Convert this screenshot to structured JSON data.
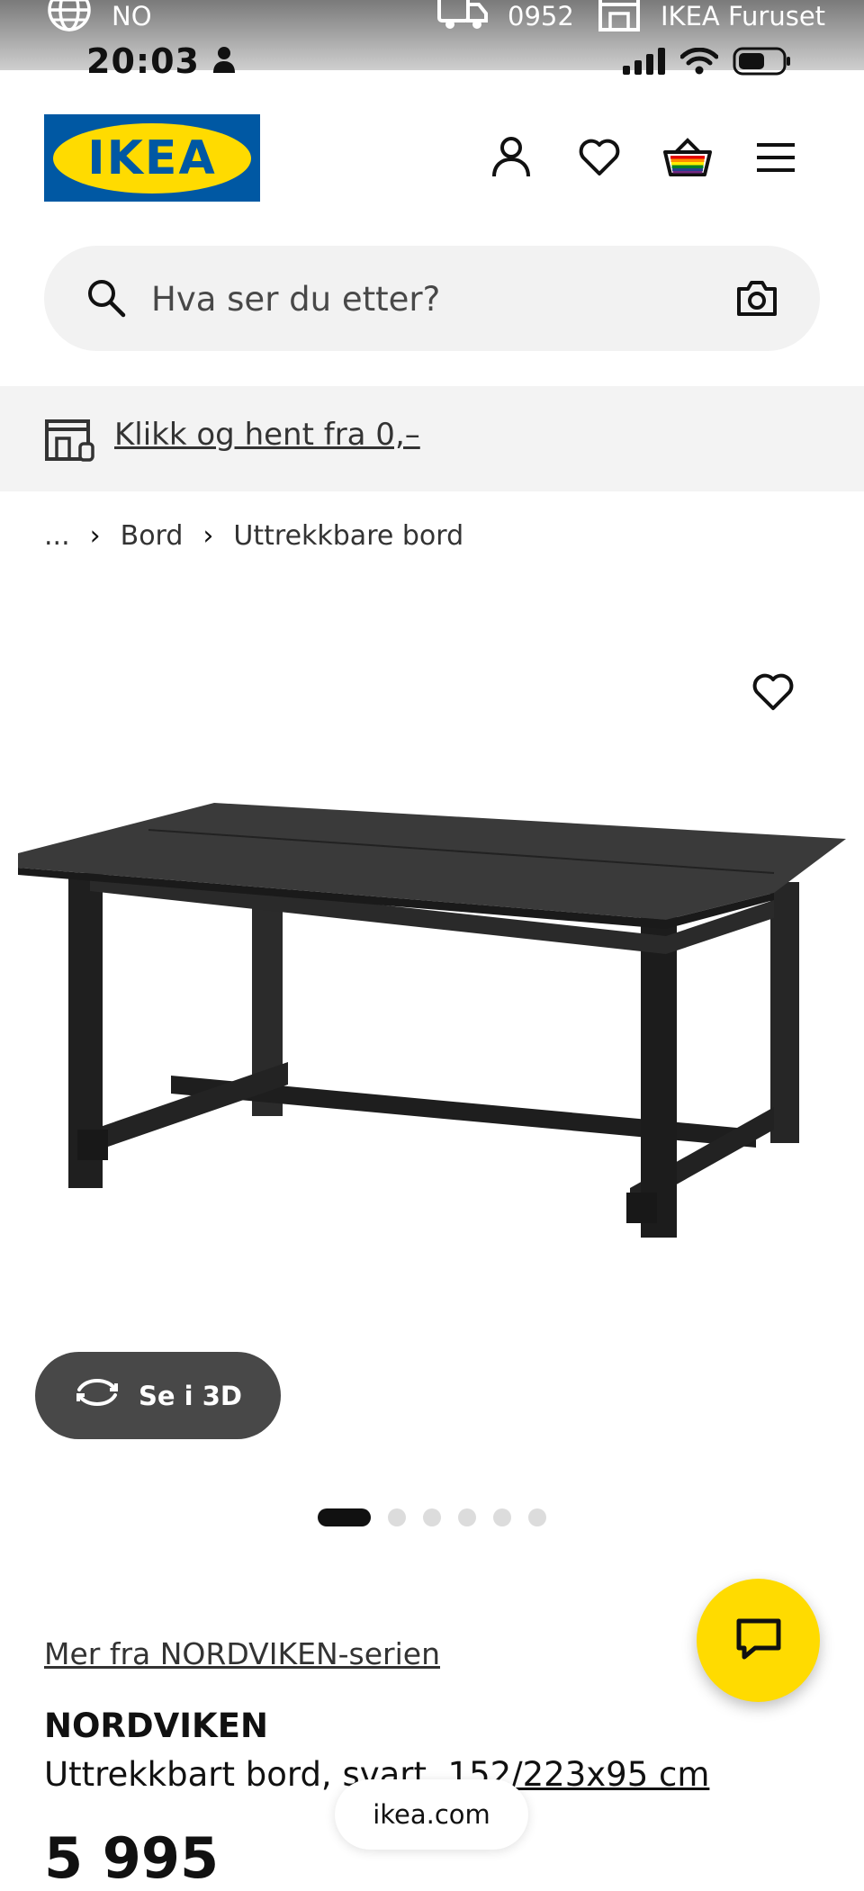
{
  "status_bar": {
    "language": "NO",
    "delivery_postcode": "0952",
    "store": "IKEA Furuset",
    "time": "20:03"
  },
  "header": {
    "logo_text": "IKEA",
    "icons": [
      "person-icon",
      "heart-icon",
      "basket-icon",
      "menu-icon"
    ]
  },
  "search": {
    "placeholder": "Hva ser du etter?"
  },
  "banner": {
    "text": "Klikk og hent fra 0,–"
  },
  "breadcrumb": {
    "ellipsis": "...",
    "items": [
      "Bord",
      "Uttrekkbare bord"
    ]
  },
  "product": {
    "view_3d_label": "Se i 3D",
    "gallery_count": 6,
    "gallery_active_index": 0,
    "series_link": "Mer fra NORDVIKEN-serien",
    "name": "NORDVIKEN",
    "description_start": "Uttrekkbart bord, svart, ",
    "description_dims": "152/223x95 cm",
    "price": "5 995"
  },
  "browser": {
    "url": "ikea.com"
  },
  "colors": {
    "ikea_blue": "#0058a3",
    "ikea_yellow": "#ffdb00",
    "text": "#111111",
    "banner_bg": "#f3f3f3"
  }
}
